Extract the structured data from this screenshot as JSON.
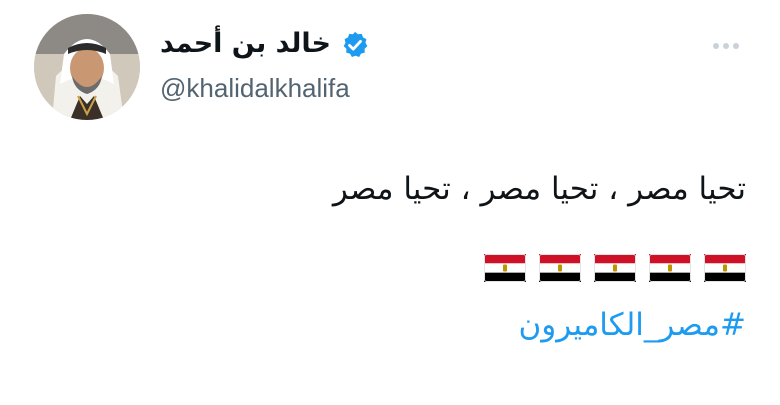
{
  "author": {
    "display_name": "خالد بن أحمد",
    "handle": "@khalidalkhalifa",
    "verified_icon": "verified-badge-icon",
    "avatar_icon": "avatar"
  },
  "tweet": {
    "text": "تحيا مصر ، تحيا مصر ، تحيا مصر",
    "flag_icon": "egypt-flag-icon",
    "flag_count": 5,
    "hashtag": "#مصر_الكاميرون"
  },
  "colors": {
    "link": "#1d9bf0",
    "verified": "#1d9bf0",
    "secondary_text": "#536471",
    "more_icon": "#c9d1d9"
  }
}
